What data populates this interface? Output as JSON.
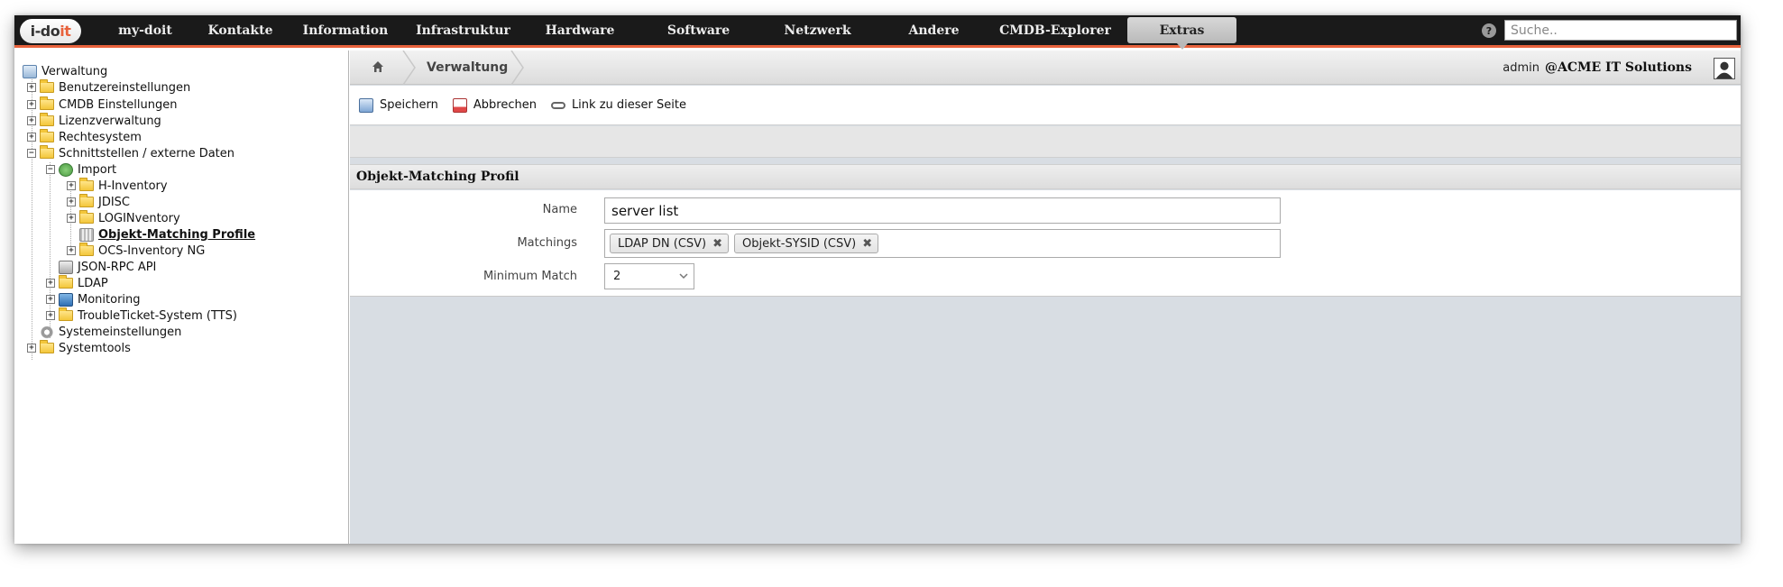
{
  "app": {
    "logo_text_a": "i-do",
    "logo_text_b": "it",
    "accent_color": "#e8623c"
  },
  "topnav": {
    "items": [
      {
        "label": "my-doit"
      },
      {
        "label": "Kontakte"
      },
      {
        "label": "Information"
      },
      {
        "label": "Infrastruktur"
      },
      {
        "label": "Hardware"
      },
      {
        "label": "Software"
      },
      {
        "label": "Netzwerk"
      },
      {
        "label": "Andere"
      },
      {
        "label": "CMDB-Explorer"
      },
      {
        "label": "Extras"
      }
    ],
    "active": "Extras",
    "help_icon": "question-icon",
    "search_placeholder": "Suche.."
  },
  "sidebar": {
    "items": [
      {
        "label": "Verwaltung",
        "icon": "calendar-icon"
      },
      {
        "label": "Benutzereinstellungen",
        "icon": "folder-icon"
      },
      {
        "label": "CMDB Einstellungen",
        "icon": "folder-icon"
      },
      {
        "label": "Lizenzverwaltung",
        "icon": "folder-icon"
      },
      {
        "label": "Rechtesystem",
        "icon": "folder-icon"
      },
      {
        "label": "Schnittstellen / externe Daten",
        "icon": "folder-open-icon"
      },
      {
        "label": "Import",
        "icon": "import-icon"
      },
      {
        "label": "H-Inventory",
        "icon": "folder-icon"
      },
      {
        "label": "JDISC",
        "icon": "folder-icon"
      },
      {
        "label": "LOGINventory",
        "icon": "folder-icon"
      },
      {
        "label": "Objekt-Matching Profile",
        "icon": "document-icon"
      },
      {
        "label": "OCS-Inventory NG",
        "icon": "folder-icon"
      },
      {
        "label": "JSON-RPC API",
        "icon": "server-icon"
      },
      {
        "label": "LDAP",
        "icon": "folder-icon"
      },
      {
        "label": "Monitoring",
        "icon": "monitor-icon"
      },
      {
        "label": "TroubleTicket-System (TTS)",
        "icon": "folder-icon"
      },
      {
        "label": "Systemeinstellungen",
        "icon": "gear-icon"
      },
      {
        "label": "Systemtools",
        "icon": "folder-icon"
      }
    ]
  },
  "breadcrumb": {
    "home_icon": "home-icon",
    "current": "Verwaltung"
  },
  "user": {
    "name": "admin",
    "company": "@ACME IT Solutions"
  },
  "toolbar": {
    "save_label": "Speichern",
    "cancel_label": "Abbrechen",
    "link_label": "Link zu dieser Seite"
  },
  "form": {
    "title": "Objekt-Matching Profil",
    "name_label": "Name",
    "name_value": "server list",
    "matchings_label": "Matchings",
    "matchings": [
      {
        "label": "LDAP DN (CSV)"
      },
      {
        "label": "Objekt-SYSID (CSV)"
      }
    ],
    "min_match_label": "Minimum Match",
    "min_match_value": "2"
  }
}
